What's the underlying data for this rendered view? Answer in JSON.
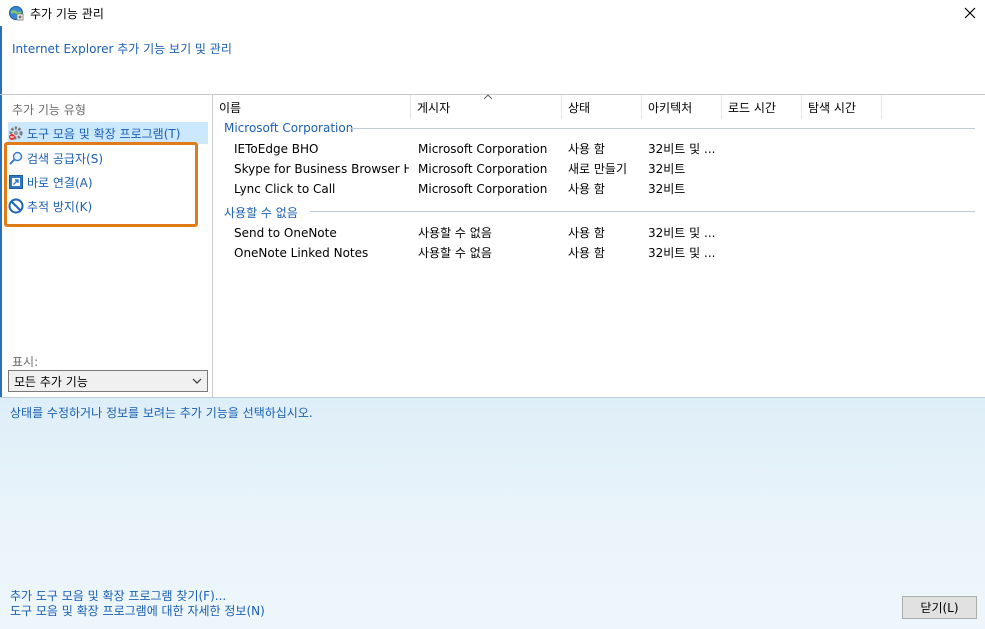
{
  "window": {
    "title": "추가 기능 관리",
    "icons": {
      "app": "ie-globe-icon",
      "close": "close-icon"
    }
  },
  "header": {
    "subtitle": "Internet Explorer 추가 기능 보기 및 관리"
  },
  "sidebar": {
    "section_label": "추가 기능 유형",
    "items": [
      {
        "label": "도구 모음 및 확장 프로그램(T)",
        "icon": "gear-icon",
        "selected": true
      },
      {
        "label": "검색 공급자(S)",
        "icon": "search-icon",
        "selected": false
      },
      {
        "label": "바로 연결(A)",
        "icon": "accelerator-icon",
        "selected": false
      },
      {
        "label": "추적 방지(K)",
        "icon": "block-icon",
        "selected": false
      }
    ],
    "show_label": "표시:",
    "show_value": "모든 추가 기능"
  },
  "list": {
    "columns": [
      "이름",
      "게시자",
      "상태",
      "아키텍처",
      "로드 시간",
      "탐색 시간"
    ],
    "groups": [
      {
        "name": "Microsoft Corporation",
        "rows": [
          {
            "name": "IEToEdge BHO",
            "publisher": "Microsoft Corporation",
            "status": "사용 함",
            "arch": "32비트 및 ..."
          },
          {
            "name": "Skype for Business Browser He...",
            "publisher": "Microsoft Corporation",
            "status": "새로 만들기",
            "arch": "32비트"
          },
          {
            "name": "Lync Click to Call",
            "publisher": "Microsoft Corporation",
            "status": "사용 함",
            "arch": "32비트"
          }
        ]
      },
      {
        "name": "사용할 수 없음",
        "rows": [
          {
            "name": "Send to OneNote",
            "publisher": "사용할 수 없음",
            "status": "사용 함",
            "arch": "32비트 및 ..."
          },
          {
            "name": "OneNote Linked Notes",
            "publisher": "사용할 수 없음",
            "status": "사용 함",
            "arch": "32비트 및 ..."
          }
        ]
      }
    ]
  },
  "details": {
    "hint": "상태를 수정하거나 정보를 보려는 추가 기능을 선택하십시오.",
    "link_find": "추가 도구 모음 및 확장 프로그램 찾기(F)...",
    "link_learn": "도구 모음 및 확장 프로그램에 대한 자세한 정보(N)",
    "close_button": "닫기(L)"
  },
  "colors": {
    "link": "#1a5fb4",
    "selection": "#cce8ff",
    "highlight_box": "#e07b1a",
    "detail_bg": "#e3f1f9"
  }
}
